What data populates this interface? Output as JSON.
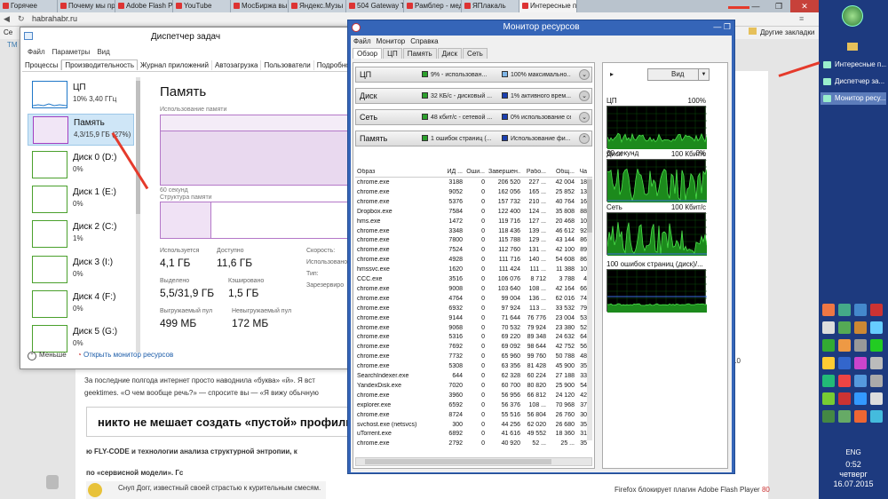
{
  "browser": {
    "tabs": [
      {
        "label": "Горячее"
      },
      {
        "label": "Почему мы пр"
      },
      {
        "label": "Adobe Flash P"
      },
      {
        "label": "YouTube"
      },
      {
        "label": "МосБиржа вы"
      },
      {
        "label": "Яндекс.Музы"
      },
      {
        "label": "504 Gateway T"
      },
      {
        "label": "Рамблер - мед"
      },
      {
        "label": "ЯПлакаль"
      },
      {
        "label": "Интересные п"
      }
    ],
    "url": "habrahabr.ru",
    "bookmark_left": "Се",
    "bookmark_left2": "ТМ",
    "other_bookmarks": "Другие закладки",
    "window_controls": {
      "minimize": "—",
      "maximize": "❐",
      "close": "✕"
    }
  },
  "article": {
    "line1": "За последние полгода интернет просто наводнила «буква» «й». Я вст",
    "line2": "geektimes. «О чем вообще речь?» — спросите вы — «Я вижу обычную",
    "headline": "никто не мешает создать «пустой» профиль в",
    "line3": "ю FLY-CODE и технологии анализа структурной энтропии, к",
    "line4": "по «сервисной модели». Гс",
    "line5": "Снуп Догг, известный своей страстью к курительным смесям.",
    "sidebar_note": "Firefox блокирует плагин Adobe Flash Player",
    "sidebar_count": "80",
    "sidebar_num": "10"
  },
  "task_manager": {
    "title": "Диспетчер задач",
    "menu": [
      "Файл",
      "Параметры",
      "Вид"
    ],
    "tabs": [
      "Процессы",
      "Производительность",
      "Журнал приложений",
      "Автозагрузка",
      "Пользователи",
      "Подробно"
    ],
    "selected_tab": "Производительность",
    "tiles": [
      {
        "name": "ЦП",
        "value": "10%  3,40 ГГц",
        "color": "#1f77c8"
      },
      {
        "name": "Память",
        "value": "4,3/15,9 ГБ (27%)",
        "color": "#a23fc1"
      },
      {
        "name": "Диск 0 (D:)",
        "value": "0%",
        "color": "#4aa02c"
      },
      {
        "name": "Диск 1 (E:)",
        "value": "0%",
        "color": "#4aa02c"
      },
      {
        "name": "Диск 2 (C:)",
        "value": "1%",
        "color": "#4aa02c"
      },
      {
        "name": "Диск 3 (I:)",
        "value": "0%",
        "color": "#4aa02c"
      },
      {
        "name": "Диск 4 (F:)",
        "value": "0%",
        "color": "#4aa02c"
      },
      {
        "name": "Диск 5 (G:)",
        "value": "0%",
        "color": "#4aa02c"
      }
    ],
    "memory": {
      "title": "Память",
      "usage_label": "Использование памяти",
      "usage_fraction": 0.27,
      "time_label": "60 секунд",
      "structure_label": "Структура памяти",
      "stats": [
        {
          "label": "Используется",
          "value": "4,1 ГБ"
        },
        {
          "label": "Доступно",
          "value": "11,6 ГБ"
        },
        {
          "label": "Выделено",
          "value": "5,5/31,9 ГБ"
        },
        {
          "label": "Кэшировано",
          "value": "1,5 ГБ"
        },
        {
          "label": "Выгружаемый пул",
          "value": "499 МБ"
        },
        {
          "label": "Невыгружаемый пул",
          "value": "172 МБ"
        }
      ],
      "right_labels": [
        "Скорость:",
        "Использовано",
        "Тип:",
        "Зарезервиро"
      ]
    },
    "footer": {
      "less": "Меньше",
      "open_monitor": "Открыть монитор ресурсов"
    }
  },
  "resource_monitor": {
    "title": "Монитор ресурсов",
    "menu": [
      "Файл",
      "Монитор",
      "Справка"
    ],
    "tabs": [
      "Обзор",
      "ЦП",
      "Память",
      "Диск",
      "Сеть"
    ],
    "selected_tab": "Обзор",
    "sections": [
      {
        "name": "ЦП",
        "a": "9% - использован...",
        "b": "100% максимально...",
        "a_color": "#2ca02c",
        "b_color": "#7fb6e8"
      },
      {
        "name": "Диск",
        "a": "32 КБ/с - дисковый ...",
        "b": "1% активного врем...",
        "a_color": "#2ca02c",
        "b_color": "#1b3fb0"
      },
      {
        "name": "Сеть",
        "a": "48 кбит/с - сетевой ...",
        "b": "0% использование сет...",
        "a_color": "#2ca02c",
        "b_color": "#1b3fb0"
      },
      {
        "name": "Память",
        "a": "1 ошибок страниц (...",
        "b": "Использование фи...",
        "a_color": "#2ca02c",
        "b_color": "#1b3fb0"
      }
    ],
    "columns": [
      "Образ",
      "ИД ...",
      "Оши...",
      "Завершен...",
      "Рабо...",
      "Общ...",
      "Ча"
    ],
    "rows": [
      [
        "chrome.exe",
        "3188",
        "0",
        "206 520",
        "227 ...",
        "42 004",
        "18"
      ],
      [
        "chrome.exe",
        "9052",
        "0",
        "162 056",
        "165 ...",
        "25 852",
        "13"
      ],
      [
        "chrome.exe",
        "5376",
        "0",
        "157 732",
        "210 ...",
        "40 764",
        "16"
      ],
      [
        "Dropbox.exe",
        "7584",
        "0",
        "122 400",
        "124 ...",
        "35 808",
        "88"
      ],
      [
        "hms.exe",
        "1472",
        "0",
        "119 716",
        "127 ...",
        "20 468",
        "10"
      ],
      [
        "chrome.exe",
        "3348",
        "0",
        "118 436",
        "139 ...",
        "46 612",
        "92"
      ],
      [
        "chrome.exe",
        "7800",
        "0",
        "115 788",
        "129 ...",
        "43 144",
        "86"
      ],
      [
        "chrome.exe",
        "7524",
        "0",
        "112 760",
        "131 ...",
        "42 100",
        "89"
      ],
      [
        "chrome.exe",
        "4928",
        "0",
        "111 716",
        "140 ...",
        "54 608",
        "86"
      ],
      [
        "hmssvc.exe",
        "1620",
        "0",
        "111 424",
        "111 ...",
        "11 388",
        "10"
      ],
      [
        "CCC.exe",
        "3516",
        "0",
        "106 076",
        "8 712",
        "3 788",
        "4"
      ],
      [
        "chrome.exe",
        "9008",
        "0",
        "103 640",
        "108 ...",
        "42 164",
        "66"
      ],
      [
        "chrome.exe",
        "4764",
        "0",
        "99 004",
        "136 ...",
        "62 016",
        "74"
      ],
      [
        "chrome.exe",
        "6932",
        "0",
        "97 924",
        "113 ...",
        "33 532",
        "79"
      ],
      [
        "chrome.exe",
        "9144",
        "0",
        "71 644",
        "76 776",
        "23 004",
        "53"
      ],
      [
        "chrome.exe",
        "9068",
        "0",
        "70 532",
        "79 924",
        "23 380",
        "52"
      ],
      [
        "chrome.exe",
        "5316",
        "0",
        "69 220",
        "89 348",
        "24 632",
        "64"
      ],
      [
        "chrome.exe",
        "7692",
        "0",
        "69 092",
        "98 644",
        "42 752",
        "56"
      ],
      [
        "chrome.exe",
        "7732",
        "0",
        "65 960",
        "99 760",
        "50 788",
        "48"
      ],
      [
        "chrome.exe",
        "5308",
        "0",
        "63 356",
        "81 428",
        "45 900",
        "35"
      ],
      [
        "SearchIndexer.exe",
        "644",
        "0",
        "62 328",
        "60 224",
        "27 188",
        "33"
      ],
      [
        "YandexDisk.exe",
        "7020",
        "0",
        "60 700",
        "80 820",
        "25 900",
        "54"
      ],
      [
        "chrome.exe",
        "3960",
        "0",
        "56 956",
        "66 812",
        "24 120",
        "42"
      ],
      [
        "explorer.exe",
        "6592",
        "0",
        "56 376",
        "108 ...",
        "70 968",
        "37"
      ],
      [
        "chrome.exe",
        "8724",
        "0",
        "55 516",
        "56 804",
        "26 760",
        "30"
      ],
      [
        "svchost.exe (netsvcs)",
        "300",
        "0",
        "44 256",
        "62 020",
        "26 680",
        "35"
      ],
      [
        "uTorrent.exe",
        "6892",
        "0",
        "41 616",
        "49 552",
        "18 360",
        "31"
      ],
      [
        "chrome.exe",
        "2792",
        "0",
        "40 920",
        "52 ...",
        "25 ...",
        "35"
      ]
    ],
    "view_label": "Вид",
    "graphs": [
      {
        "name": "ЦП",
        "max": "100%",
        "bottom": "60 секунд",
        "bottom_right": "0%"
      },
      {
        "name": "Диск",
        "max": "100 Кбит/с",
        "bottom": "",
        "bottom_right": ""
      },
      {
        "name": "Сеть",
        "max": "100 Кбит/с",
        "bottom": "",
        "bottom_right": ""
      },
      {
        "name": "100 ошибок страниц (диск)/...",
        "max": "",
        "bottom": "",
        "bottom_right": ""
      }
    ]
  },
  "taskbar": {
    "items": [
      {
        "label": "Интересные п...",
        "selected": false
      },
      {
        "label": "Диспетчер за...",
        "selected": false
      },
      {
        "label": "Монитор ресу...",
        "selected": true
      }
    ],
    "language": "ENG",
    "time": "0:52",
    "day": "четверг",
    "date": "16.07.2015"
  }
}
